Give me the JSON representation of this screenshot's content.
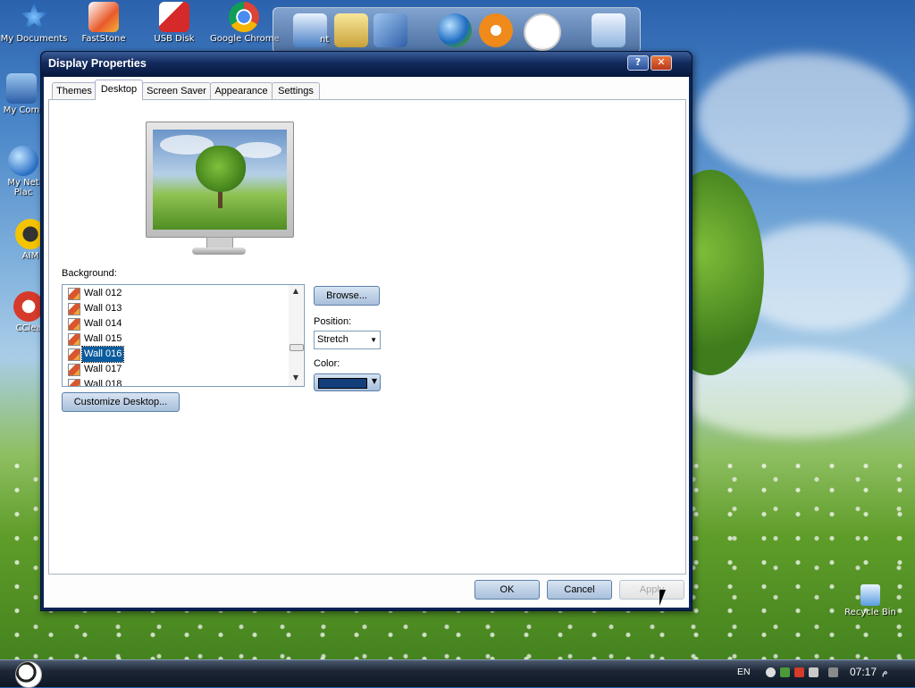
{
  "desktop": {
    "icons": [
      {
        "label": "My Documents"
      },
      {
        "label": "FastStone"
      },
      {
        "label": "USB Disk"
      },
      {
        "label": "Google Chrome"
      },
      {
        "label": "My Com"
      },
      {
        "label": "My Net"
      },
      {
        "label": "Plac"
      },
      {
        "label": "AIM"
      },
      {
        "label": "CClea"
      },
      {
        "label": "Recycle Bin"
      }
    ],
    "dock_label_fragment": "nt"
  },
  "dialog": {
    "title": "Display Properties",
    "help_label": "?",
    "close_label": "✕",
    "tabs": [
      {
        "label": "Themes"
      },
      {
        "label": "Desktop"
      },
      {
        "label": "Screen Saver"
      },
      {
        "label": "Appearance"
      },
      {
        "label": "Settings"
      }
    ],
    "active_tab": "Desktop",
    "background_label": "Background:",
    "background_items": [
      {
        "label": "Wall 012"
      },
      {
        "label": "Wall 013"
      },
      {
        "label": "Wall 014"
      },
      {
        "label": "Wall 015"
      },
      {
        "label": "Wall 016",
        "selected": true
      },
      {
        "label": "Wall 017"
      },
      {
        "label": "Wall 018"
      }
    ],
    "browse_label": "Browse...",
    "position_label": "Position:",
    "position_value": "Stretch",
    "color_label": "Color:",
    "color_value": "#123f7a",
    "customize_label": "Customize Desktop...",
    "ok_label": "OK",
    "cancel_label": "Cancel",
    "apply_label": "Apply"
  },
  "taskbar": {
    "language": "EN",
    "clock": "07:17",
    "clock_suffix": "م"
  }
}
